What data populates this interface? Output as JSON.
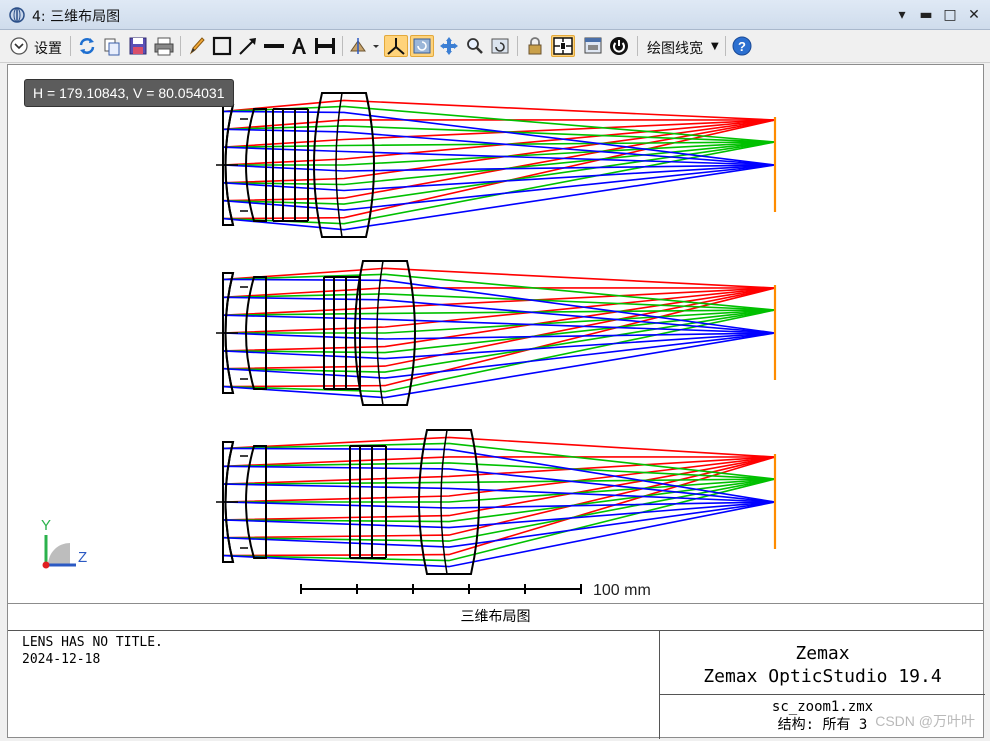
{
  "window": {
    "title": "4: 三维布局图",
    "controls": [
      "▾",
      "🗖",
      "□",
      "✕"
    ]
  },
  "toolbar": {
    "settings_label": "设置",
    "linewidth_label": "绘图线宽",
    "icons": [
      "refresh-icon",
      "copy-icon",
      "save-icon",
      "print-icon",
      "pencil-icon",
      "rectangle-icon",
      "arrow-line-icon",
      "line-icon",
      "text-icon",
      "dimension-icon",
      "rotate-3d-icon",
      "axes-icon",
      "reset-view-icon",
      "pan-icon",
      "zoom-icon",
      "undo-view-icon",
      "lock-icon",
      "fit-icon",
      "window-icon",
      "power-icon",
      "help-icon"
    ]
  },
  "plot": {
    "cursor_readout": "H = 179.10843, V = 80.054031",
    "scale_label": "100 mm",
    "axis_y": "Y",
    "axis_z": "Z",
    "ray_colors": {
      "field1": "#0000ff",
      "field2": "#00c000",
      "field3": "#ff0000"
    },
    "image_plane_color": "#ff8c00"
  },
  "footer": {
    "caption": "三维布局图",
    "lens_title": "LENS HAS NO TITLE.",
    "date": "2024-12-18",
    "vendor": "Zemax",
    "product": "Zemax OpticStudio 19.4",
    "file": "sc_zoom1.zmx",
    "config": "结构: 所有 3",
    "watermark": "CSDN @万叶叶"
  }
}
